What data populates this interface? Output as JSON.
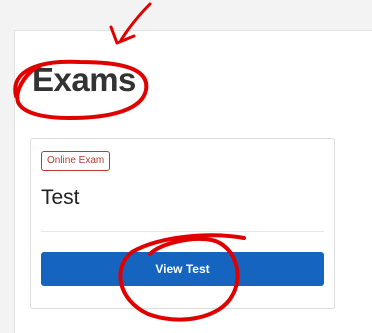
{
  "page": {
    "title": "Exams"
  },
  "exam_card": {
    "badge": "Online Exam",
    "title": "Test",
    "action_label": "View Test"
  },
  "colors": {
    "primary_button": "#1565c0",
    "badge_accent": "#b73b30",
    "annotation": "#e00000"
  }
}
